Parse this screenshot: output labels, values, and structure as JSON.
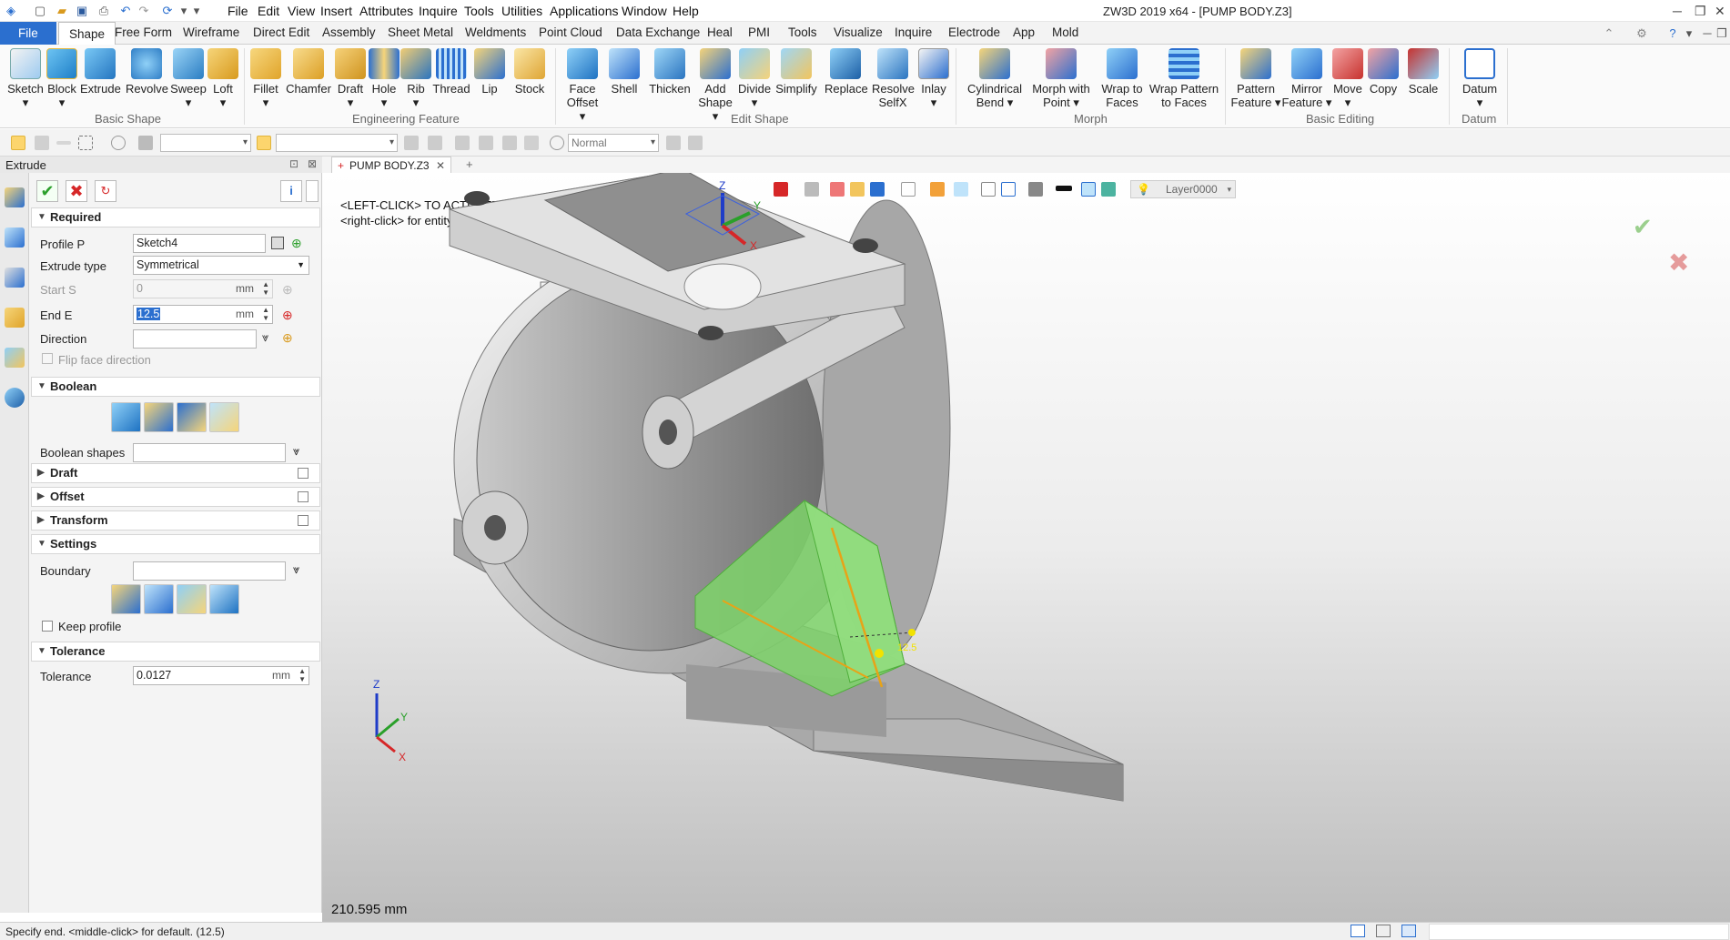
{
  "titlebar": {
    "app_title": "ZW3D 2019  x64 - [PUMP BODY.Z3]",
    "menu": [
      "File",
      "Edit",
      "View",
      "Insert",
      "Attributes",
      "Inquire",
      "Tools",
      "Utilities",
      "Applications",
      "Window",
      "Help"
    ]
  },
  "tabs": [
    "File",
    "Shape",
    "Free Form",
    "Wireframe",
    "Direct Edit",
    "Assembly",
    "Sheet Metal",
    "Weldments",
    "Point Cloud",
    "Data Exchange",
    "Heal",
    "PMI",
    "Tools",
    "Visualize",
    "Inquire",
    "Electrode",
    "App",
    "Mold"
  ],
  "ribbon": {
    "buttons": [
      {
        "label": "Sketch",
        "sub": "▾"
      },
      {
        "label": "Block",
        "sub": "▾"
      },
      {
        "label": "Extrude",
        "sub": ""
      },
      {
        "label": "Revolve",
        "sub": ""
      },
      {
        "label": "Sweep",
        "sub": "▾"
      },
      {
        "label": "Loft",
        "sub": "▾"
      },
      {
        "label": "Fillet",
        "sub": "▾"
      },
      {
        "label": "Chamfer",
        "sub": ""
      },
      {
        "label": "Draft",
        "sub": "▾"
      },
      {
        "label": "Hole",
        "sub": "▾"
      },
      {
        "label": "Rib",
        "sub": "▾"
      },
      {
        "label": "Thread",
        "sub": ""
      },
      {
        "label": "Lip",
        "sub": ""
      },
      {
        "label": "Stock",
        "sub": ""
      },
      {
        "label": "Face",
        "sub": "Offset ▾"
      },
      {
        "label": "Shell",
        "sub": ""
      },
      {
        "label": "Thicken",
        "sub": ""
      },
      {
        "label": "Add",
        "sub": "Shape ▾"
      },
      {
        "label": "Divide",
        "sub": "▾"
      },
      {
        "label": "Simplify",
        "sub": ""
      },
      {
        "label": "Replace",
        "sub": ""
      },
      {
        "label": "Resolve",
        "sub": "SelfX"
      },
      {
        "label": "Inlay",
        "sub": "▾"
      },
      {
        "label": "Cylindrical",
        "sub": "Bend  ▾"
      },
      {
        "label": "Morph with",
        "sub": "Point  ▾"
      },
      {
        "label": "Wrap to",
        "sub": "Faces"
      },
      {
        "label": "Wrap Pattern",
        "sub": "to Faces"
      },
      {
        "label": "Pattern",
        "sub": "Feature ▾"
      },
      {
        "label": "Mirror",
        "sub": "Feature ▾"
      },
      {
        "label": "Move",
        "sub": "▾"
      },
      {
        "label": "Copy",
        "sub": ""
      },
      {
        "label": "Scale",
        "sub": ""
      },
      {
        "label": "Datum",
        "sub": "▾"
      }
    ],
    "groups": [
      "Basic Shape",
      "Engineering Feature",
      "Edit Shape",
      "Morph",
      "Basic Editing",
      "Datum"
    ]
  },
  "toolbar2": {
    "render_mode": "Normal"
  },
  "panel": {
    "title": "Extrude",
    "sections": {
      "required": "Required",
      "boolean": "Boolean",
      "draft": "Draft",
      "offset": "Offset",
      "transform": "Transform",
      "settings": "Settings",
      "tolerance": "Tolerance"
    },
    "fields": {
      "profile_label": "Profile P",
      "profile_value": "Sketch4",
      "type_label": "Extrude type",
      "type_value": "Symmetrical",
      "start_label": "Start S",
      "start_value": "0",
      "start_unit": "mm",
      "end_label": "End E",
      "end_value": "12.5",
      "end_unit": "mm",
      "direction_label": "Direction",
      "flip_label": "Flip face direction",
      "boolean_shapes_label": "Boolean shapes",
      "boundary_label": "Boundary",
      "keep_profile_label": "Keep profile",
      "tolerance_label": "Tolerance",
      "tolerance_value": "0.0127",
      "tolerance_unit": "mm"
    }
  },
  "document": {
    "tab": "PUMP BODY.Z3",
    "layer": "Layer0000"
  },
  "viewport": {
    "hint1": "<LEFT-CLICK> TO ACTIVATE DYNAMIC PICK INPUT.",
    "hint2": "<right-click> for entity input options.",
    "dimension": "210.595 mm",
    "dim_tag": "12.5",
    "axes": {
      "x": "X",
      "y": "Y",
      "z": "Z"
    }
  },
  "status": {
    "message": "Specify end.   <middle-click> for default. (12.5)"
  },
  "colors": {
    "accent": "#2b6fcf",
    "highlight": "#fcd56d",
    "preview": "#7ed36a",
    "accept": "#2ca02c",
    "cancel": "#d62728"
  }
}
